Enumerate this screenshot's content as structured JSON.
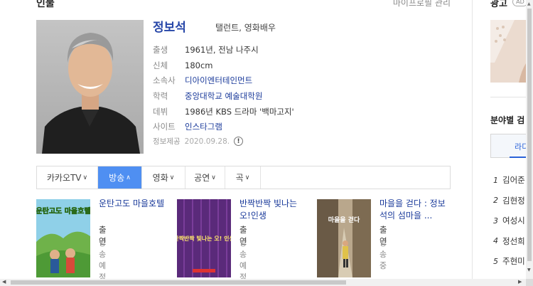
{
  "section": {
    "title": "인물",
    "manage_link": "마이프로필 관리"
  },
  "profile": {
    "name": "정보석",
    "subtitle": "탤런트, 영화배우",
    "info": [
      {
        "key": "출생",
        "value": "1961년, 전남 나주시"
      },
      {
        "key": "신체",
        "value": "180cm"
      },
      {
        "key": "소속사",
        "value": "디아이엔터테인먼트"
      },
      {
        "key": "학력",
        "value": "중앙대학교 예술대학원"
      },
      {
        "key": "데뷔",
        "value": "1986년 KBS 드라마 '백마고지'"
      },
      {
        "key": "사이트",
        "value": "인스타그램"
      }
    ],
    "source_label": "정보제공",
    "source_date": "2020.09.28.",
    "source_icon": "!"
  },
  "tabs": [
    {
      "label": "카카오TV",
      "caret": "∨"
    },
    {
      "label": "방송",
      "caret": "∧"
    },
    {
      "label": "영화",
      "caret": "∨"
    },
    {
      "label": "공연",
      "caret": "∨"
    },
    {
      "label": "곡",
      "caret": "∨"
    }
  ],
  "cards": [
    {
      "title": "운탄고도 마을호텔",
      "role": "출연",
      "status": "방송예정",
      "poster_text": "운탄고도 마을호텔"
    },
    {
      "title": "반짝반짝 빛나는 오!인생",
      "role": "출연",
      "status": "방송예정",
      "poster_text": "반짝반짝 빛나는 오! 인생"
    },
    {
      "title": "마을을 걷다 : 정보석의 섬마을 ...",
      "role": "출연",
      "status": "방송중",
      "poster_text": "마을을 걷다"
    }
  ],
  "right": {
    "ad_label": "광고",
    "ad_badge": "AD",
    "category_title": "분야별 검",
    "category_tab": "라디",
    "list": [
      {
        "num": "1",
        "text": "김어준"
      },
      {
        "num": "2",
        "text": "김현정"
      },
      {
        "num": "3",
        "text": "여성시"
      },
      {
        "num": "4",
        "text": "정선희"
      },
      {
        "num": "5",
        "text": "주현미"
      }
    ]
  },
  "colors": {
    "accent": "#4f8ff2",
    "link": "#1a3a9a",
    "name": "#2646a8"
  }
}
